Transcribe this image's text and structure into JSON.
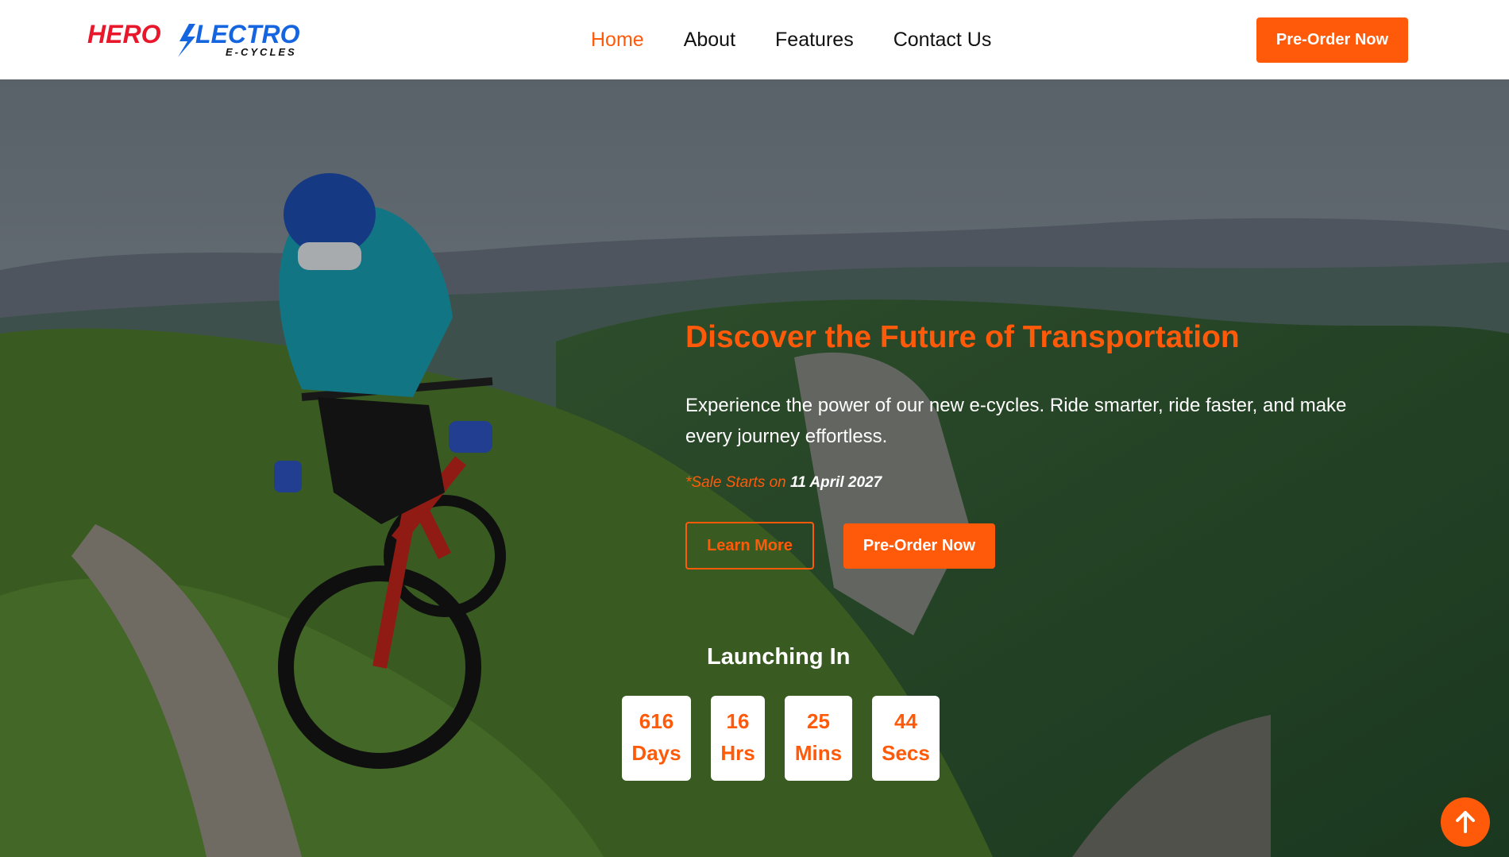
{
  "brand": {
    "logo_word1": "HERO",
    "logo_word2": "LECTRO",
    "logo_sub": "E-CYCLES",
    "colors": {
      "red": "#e8172b",
      "blue": "#1565e0"
    }
  },
  "nav": {
    "items": [
      {
        "label": "Home",
        "active": true
      },
      {
        "label": "About",
        "active": false
      },
      {
        "label": "Features",
        "active": false
      },
      {
        "label": "Contact Us",
        "active": false
      }
    ],
    "cta_label": "Pre-Order Now"
  },
  "hero": {
    "title": "Discover the Future of Transportation",
    "description": "Experience the power of our new e-cycles. Ride smarter, ride faster, and make every journey effortless.",
    "sale_label": "*Sale Starts on",
    "sale_date": "11 April 2027",
    "learn_more_label": "Learn More",
    "preorder_label": "Pre-Order Now"
  },
  "countdown": {
    "heading": "Launching In",
    "units": [
      {
        "value": "616",
        "unit": "Days"
      },
      {
        "value": "16",
        "unit": "Hrs"
      },
      {
        "value": "25",
        "unit": "Mins"
      },
      {
        "value": "44",
        "unit": "Secs"
      }
    ]
  },
  "scroll_top_icon": "arrow-up-icon",
  "colors": {
    "accent": "#ff5a0a",
    "white": "#ffffff",
    "text": "#111111"
  }
}
